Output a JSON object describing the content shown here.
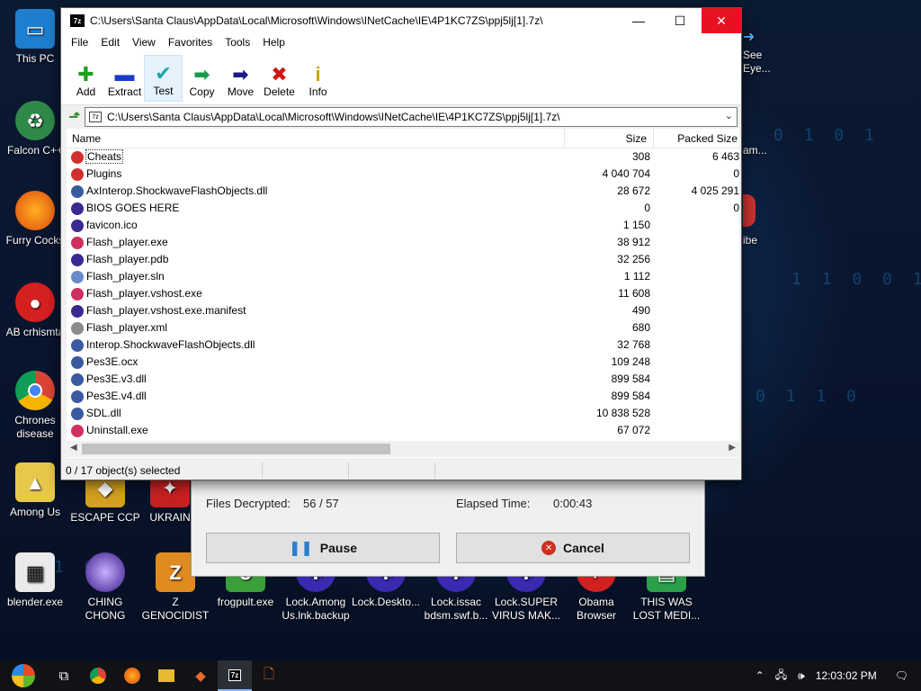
{
  "window": {
    "title": "C:\\Users\\Santa Claus\\AppData\\Local\\Microsoft\\Windows\\INetCache\\IE\\4P1KC7ZS\\ppj5lj[1].7z\\",
    "app_icon": "7z",
    "controls": {
      "minimize": "—",
      "maximize": "☐",
      "close": "✕"
    }
  },
  "menu": [
    "File",
    "Edit",
    "View",
    "Favorites",
    "Tools",
    "Help"
  ],
  "toolbar": [
    {
      "label": "Add",
      "icon": "plus-icon",
      "glyph": "✚",
      "color": "#1aa31a"
    },
    {
      "label": "Extract",
      "icon": "extract-icon",
      "glyph": "▬",
      "color": "#1a3cc8"
    },
    {
      "label": "Test",
      "icon": "test-check-icon",
      "glyph": "✔",
      "color": "#1aa8a8"
    },
    {
      "label": "Copy",
      "icon": "copy-arrow-icon",
      "glyph": "➡",
      "color": "#1a9a4a"
    },
    {
      "label": "Move",
      "icon": "move-arrow-icon",
      "glyph": "➡",
      "color": "#1a1a8a"
    },
    {
      "label": "Delete",
      "icon": "delete-x-icon",
      "glyph": "✖",
      "color": "#d01515"
    },
    {
      "label": "Info",
      "icon": "info-icon",
      "glyph": "i",
      "color": "#c8a800"
    }
  ],
  "address": "C:\\Users\\Santa Claus\\AppData\\Local\\Microsoft\\Windows\\INetCache\\IE\\4P1KC7ZS\\ppj5lj[1].7z\\",
  "columns": {
    "name": "Name",
    "size": "Size",
    "packed": "Packed Size"
  },
  "files": [
    {
      "name": "Cheats",
      "size": "308",
      "packed": "6 463",
      "icon": "folder-icon",
      "color": "#d03030"
    },
    {
      "name": "Plugins",
      "size": "4 040 704",
      "packed": "0",
      "icon": "folder-icon",
      "color": "#d03030"
    },
    {
      "name": "AxInterop.ShockwaveFlashObjects.dll",
      "size": "28 672",
      "packed": "4 025 291",
      "icon": "dll-gear-icon",
      "color": "#3a5aa0"
    },
    {
      "name": "BIOS GOES HERE",
      "size": "0",
      "packed": "0",
      "icon": "blank-file-icon",
      "color": "#3a2a90"
    },
    {
      "name": "favicon.ico",
      "size": "1 150",
      "packed": "",
      "icon": "ico-file-icon",
      "color": "#3a2a90"
    },
    {
      "name": "Flash_player.exe",
      "size": "38 912",
      "packed": "",
      "icon": "exe-icon",
      "color": "#d03060"
    },
    {
      "name": "Flash_player.pdb",
      "size": "32 256",
      "packed": "",
      "icon": "pdb-file-icon",
      "color": "#3a2a90"
    },
    {
      "name": "Flash_player.sln",
      "size": "1 112",
      "packed": "",
      "icon": "sln-file-icon",
      "color": "#6a8ac8"
    },
    {
      "name": "Flash_player.vshost.exe",
      "size": "11 608",
      "packed": "",
      "icon": "exe-icon",
      "color": "#d03060"
    },
    {
      "name": "Flash_player.vshost.exe.manifest",
      "size": "490",
      "packed": "",
      "icon": "manifest-file-icon",
      "color": "#3a2a90"
    },
    {
      "name": "Flash_player.xml",
      "size": "680",
      "packed": "",
      "icon": "xml-file-icon",
      "color": "#8a8a8a"
    },
    {
      "name": "Interop.ShockwaveFlashObjects.dll",
      "size": "32 768",
      "packed": "",
      "icon": "dll-gear-icon",
      "color": "#3a5aa0"
    },
    {
      "name": "Pes3E.ocx",
      "size": "109 248",
      "packed": "",
      "icon": "ocx-gear-icon",
      "color": "#3a5aa0"
    },
    {
      "name": "Pes3E.v3.dll",
      "size": "899 584",
      "packed": "",
      "icon": "dll-gear-icon",
      "color": "#3a5aa0"
    },
    {
      "name": "Pes3E.v4.dll",
      "size": "899 584",
      "packed": "",
      "icon": "dll-gear-icon",
      "color": "#3a5aa0"
    },
    {
      "name": "SDL.dll",
      "size": "10 838 528",
      "packed": "",
      "icon": "dll-gear-icon",
      "color": "#3a5aa0"
    },
    {
      "name": "Uninstall.exe",
      "size": "67 072",
      "packed": "",
      "icon": "exe-icon",
      "color": "#d03060"
    }
  ],
  "status": "0 / 17 object(s) selected",
  "progress": {
    "files_label": "Files Decrypted:",
    "files_value": "56 / 57",
    "elapsed_label": "Elapsed Time:",
    "elapsed_value": "0:00:43",
    "pause_label": "Pause",
    "cancel_label": "Cancel"
  },
  "desktop_icons": [
    {
      "label": "This PC",
      "icon": "computer-icon"
    },
    {
      "label": "Falcon C++",
      "icon": "recycle-icon"
    },
    {
      "label": "Furry Cocks",
      "icon": "firefox-icon"
    },
    {
      "label": "AB crhismta",
      "icon": "angry-bird-icon"
    },
    {
      "label": "Chrones disease",
      "icon": "chrome-icon"
    },
    {
      "label": "Among Us",
      "icon": "among-us-icon"
    },
    {
      "label": "blender.exe",
      "icon": "blender-icon"
    },
    {
      "label": "ESCAPE CCP",
      "icon": "escape-icon"
    },
    {
      "label": "UKRAIN",
      "icon": "ukrain-icon"
    },
    {
      "label": "CHING CHONG",
      "icon": "orb-icon"
    },
    {
      "label": "Z GENOCIDIST",
      "icon": "zgen-icon"
    },
    {
      "label": "frogpult.exe",
      "icon": "frog-icon"
    },
    {
      "label": "Lock.Among Us.lnk.backup",
      "icon": "lock-icon"
    },
    {
      "label": "Lock.Deskto...",
      "icon": "lock-icon"
    },
    {
      "label": "Lock.issac bdsm.swf.b...",
      "icon": "lock-icon"
    },
    {
      "label": "Lock.SUPER VIRUS MAK...",
      "icon": "lock-icon"
    },
    {
      "label": "Obama Browser",
      "icon": "obama-icon"
    },
    {
      "label": "THIS WAS LOST MEDI...",
      "icon": "book-icon"
    },
    {
      "label": "See Eye...",
      "icon": "see-eye-icon"
    },
    {
      "label": "am...",
      "icon": "am-icon"
    },
    {
      "label": "ibe",
      "icon": "ibe-icon"
    }
  ],
  "taskbar": {
    "clock": "12:03:02 PM",
    "items": [
      "start-orb-icon",
      "task-view-icon",
      "chrome-icon",
      "firefox-icon",
      "explorer-folder-icon",
      "app-icon",
      "7zip-icon",
      "lock-file-icon"
    ]
  }
}
